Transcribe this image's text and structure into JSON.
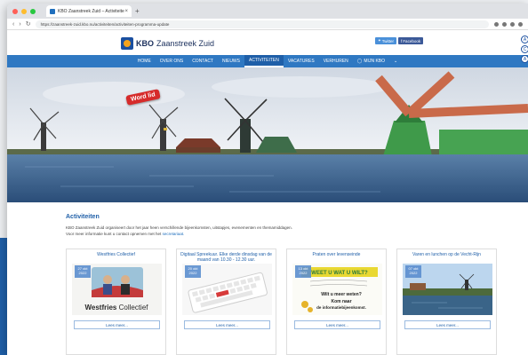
{
  "browser": {
    "tab_title": "KBO Zaanstreek Zuid – Activiteiten",
    "tab_close": "×",
    "new_tab": "+",
    "back": "‹",
    "forward": "›",
    "reload": "↻",
    "url": "https://zaanstreek-zuid.kbo.nu/activiteiten/activiteiten-programma-update"
  },
  "site": {
    "logo_text": "KBO",
    "logo_sub": "Zaanstreek Zuid",
    "twitter": "Twitter",
    "facebook": "Facebook",
    "side_icons": [
      "A",
      "C",
      "A"
    ]
  },
  "nav": {
    "items": [
      {
        "label": "Home",
        "active": false
      },
      {
        "label": "Over ons",
        "active": false
      },
      {
        "label": "Contact",
        "active": false
      },
      {
        "label": "Nieuws",
        "active": false
      },
      {
        "label": "Activiteiten",
        "active": true
      },
      {
        "label": "Vacatures",
        "active": false
      },
      {
        "label": "Verhuren",
        "active": false
      },
      {
        "label": "Mijn KBO",
        "active": false
      }
    ],
    "more": "⌄"
  },
  "hero": {
    "badge": "Word lid"
  },
  "section": {
    "title": "Activiteiten",
    "intro": "KBO Zaanstreek Zuid organiseert door het jaar heen verschillende bijeenkomsten, uitstapjes, evenementen en themamiddagen.",
    "intro2": "Voor meer informatie kunt u contact opnemen met het",
    "intro_link": "secretariaat."
  },
  "cards": [
    {
      "title": "Westfries Collectief",
      "date": "27 okt 2022",
      "read": "Lees meer..."
    },
    {
      "title": "Digitaal Spreekuur. Elke derde dinsdag van de maand van 10.30 - 12.30 uur.",
      "date": "20 okt 2022",
      "read": "Lees meer..."
    },
    {
      "title": "Praten over levenseinde",
      "date": "13 okt 2022",
      "read": "Lees meer..."
    },
    {
      "title": "Varen en lunchen op de Vecht-Rijn",
      "date": "07 okt 2022",
      "read": "Lees meer..."
    }
  ],
  "card_art": {
    "westfries_word1": "Westfries",
    "westfries_word2": "Collectief",
    "info_line1": "WEET U WAT U WILT?",
    "info_line2": "Wilt u meer weten?",
    "info_line3": "Kom naar",
    "info_line4": "de informatiebijeenkomst."
  },
  "colors": {
    "nav": "#2f78c2",
    "nav_active": "#1f5fa8",
    "badge": "#d62b2b",
    "link": "#1f6fbd"
  }
}
